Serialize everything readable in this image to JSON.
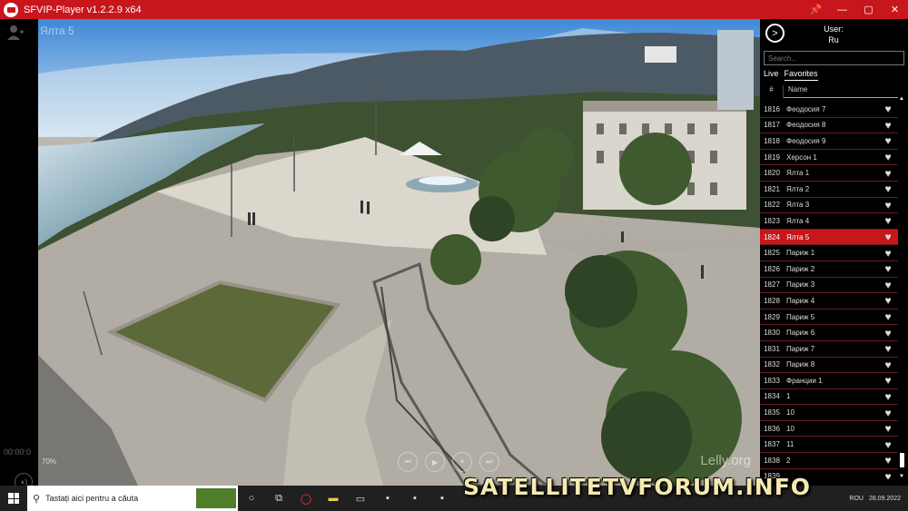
{
  "window": {
    "title": "SFVIP-Player v1.2.2.9 x64",
    "buttons": {
      "pin": "📌",
      "minimize": "—",
      "maximize": "▢",
      "close": "✕"
    }
  },
  "left": {
    "time": "00:00:0"
  },
  "video": {
    "channel_label": "Ялта 5",
    "watermark": "Lelly.org",
    "volume": "70%",
    "controls": {
      "prev": "⏮",
      "play": "▶",
      "pause": "⏸",
      "next": "⏭"
    }
  },
  "panel": {
    "user_label": "User:",
    "user_value": "Ru",
    "search_placeholder": "Search...",
    "tabs": [
      "Live",
      "Favorites"
    ],
    "col_num": "#",
    "col_name": "Name",
    "channels": [
      {
        "num": "1816",
        "name": "Феодосия 7"
      },
      {
        "num": "1817",
        "name": "Феодосия 8"
      },
      {
        "num": "1818",
        "name": "Феодосия 9"
      },
      {
        "num": "1819",
        "name": "Херсон 1"
      },
      {
        "num": "1820",
        "name": "Ялта 1"
      },
      {
        "num": "1821",
        "name": "Ялта 2"
      },
      {
        "num": "1822",
        "name": "Ялта 3"
      },
      {
        "num": "1823",
        "name": "Ялта 4"
      },
      {
        "num": "1824",
        "name": "Ялта 5"
      },
      {
        "num": "1825",
        "name": "Париж 1"
      },
      {
        "num": "1826",
        "name": "Париж 2"
      },
      {
        "num": "1827",
        "name": "Париж 3"
      },
      {
        "num": "1828",
        "name": "Париж 4"
      },
      {
        "num": "1829",
        "name": "Париж 5"
      },
      {
        "num": "1830",
        "name": "Париж 6"
      },
      {
        "num": "1831",
        "name": "Париж 7"
      },
      {
        "num": "1832",
        "name": "Париж 8"
      },
      {
        "num": "1833",
        "name": "Франции 1"
      },
      {
        "num": "1834",
        "name": "1"
      },
      {
        "num": "1835",
        "name": "10"
      },
      {
        "num": "1836",
        "name": "10"
      },
      {
        "num": "1837",
        "name": "11"
      },
      {
        "num": "1838",
        "name": "2"
      },
      {
        "num": "1839",
        "name": ""
      }
    ],
    "selected_num": "1824"
  },
  "taskbar": {
    "search_text": "Tastați aici pentru a căuta",
    "language": "ROU",
    "date": "28.09.2022"
  },
  "overlay": {
    "forum_banner": "SATELLITETVFORUM.INFO"
  },
  "colors": {
    "titlebar": "#c8161d",
    "selected_row": "#c8161d",
    "row_divider": "#6a1a1e",
    "taskbar": "#202020"
  }
}
